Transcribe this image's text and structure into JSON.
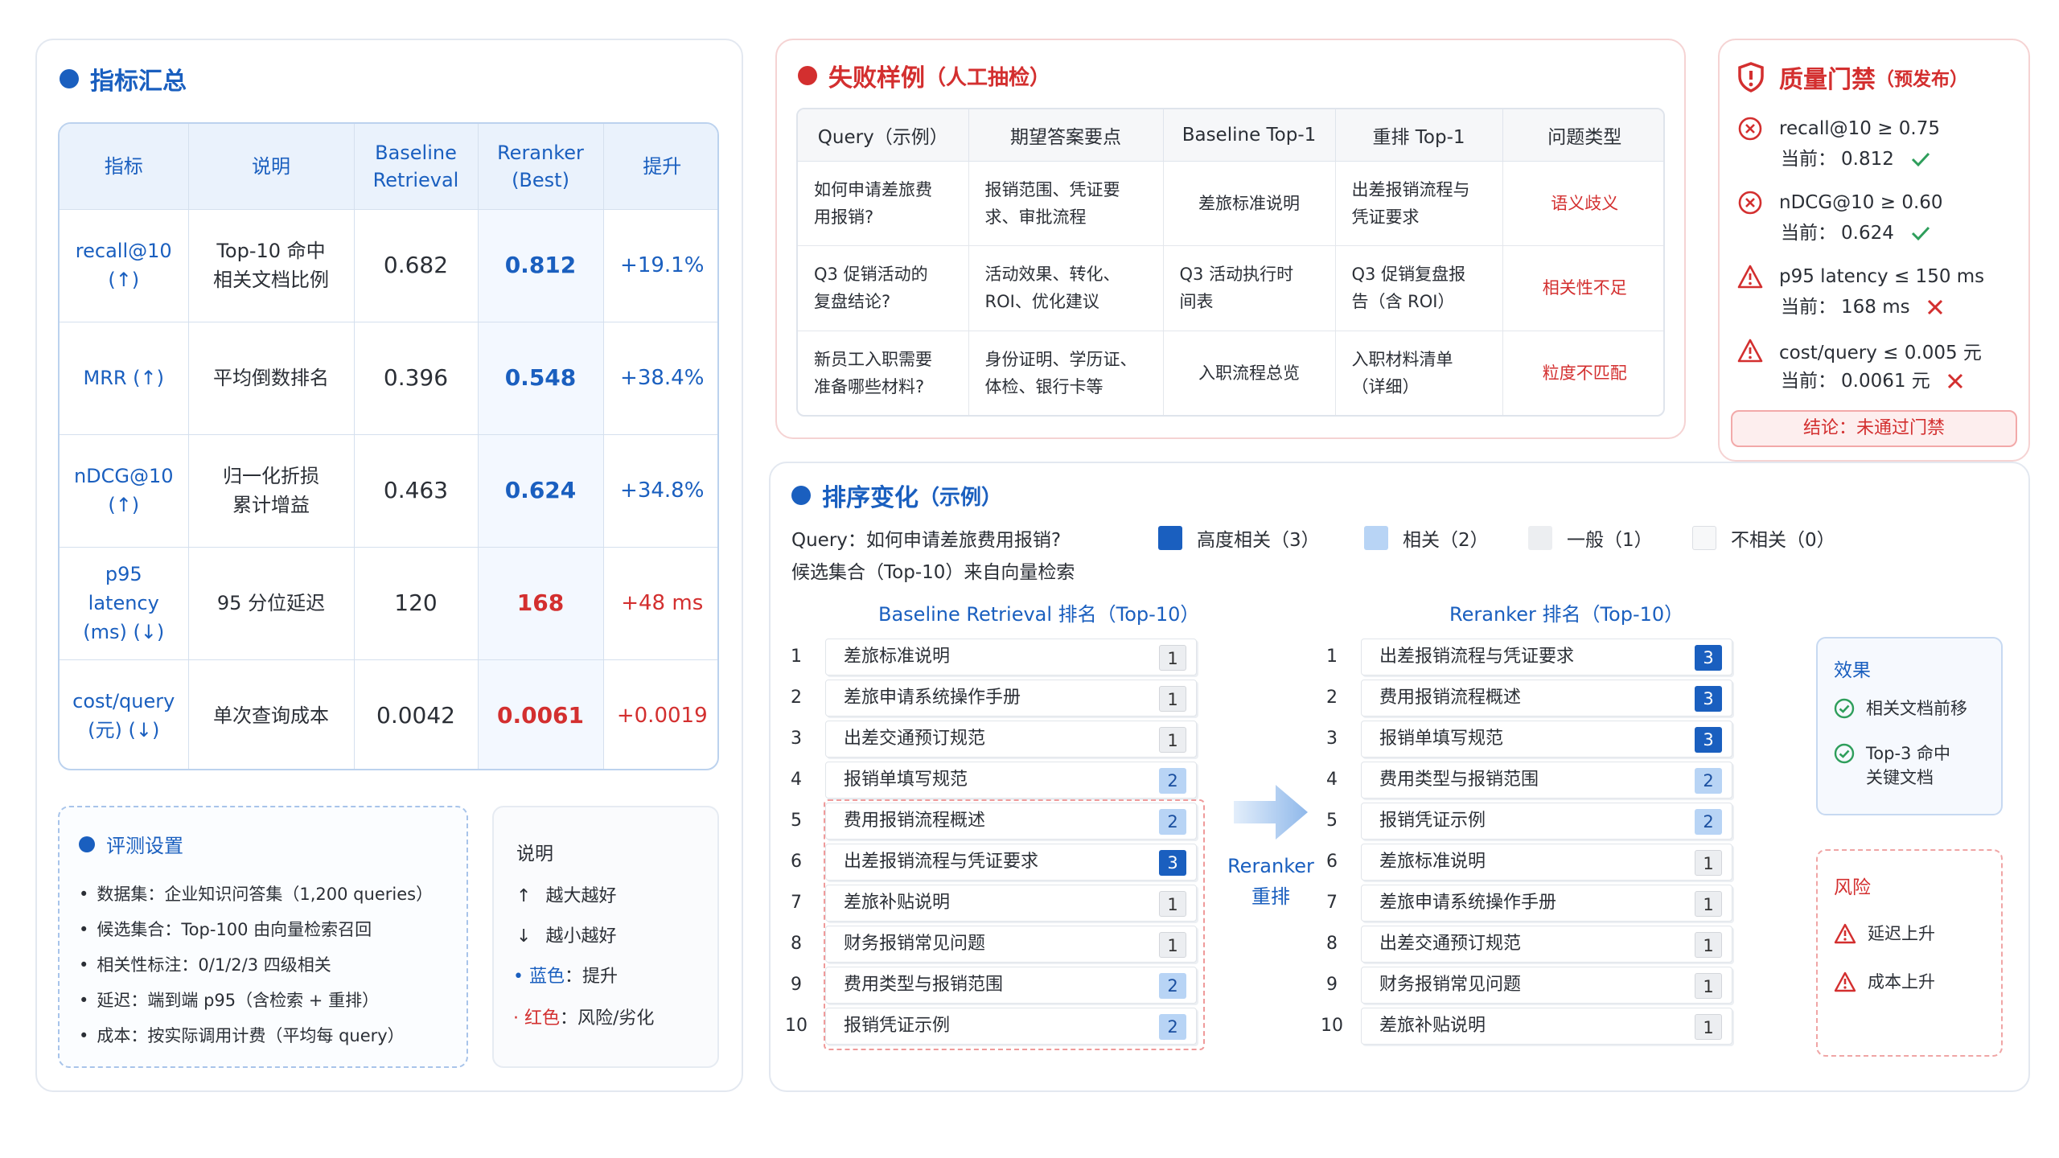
{
  "metrics": {
    "title": "指标汇总",
    "headers": [
      "指标",
      "说明",
      "Baseline Retrieval",
      "Reranker (Best)",
      "提升"
    ],
    "rows": [
      {
        "metric": "recall@10 (↑)",
        "desc": "Top-10 命中 相关文档比例",
        "baseline": "0.682",
        "reranker": "0.812",
        "gain": "+19.1%",
        "bad": false
      },
      {
        "metric": "MRR (↑)",
        "desc": "平均倒数排名",
        "baseline": "0.396",
        "reranker": "0.548",
        "gain": "+38.4%",
        "bad": false
      },
      {
        "metric": "nDCG@10 (↑)",
        "desc": "归一化折损 累计增益",
        "baseline": "0.463",
        "reranker": "0.624",
        "gain": "+34.8%",
        "bad": false
      },
      {
        "metric": "p95 latency (ms) (↓)",
        "desc": "95 分位延迟",
        "baseline": "120",
        "reranker": "168",
        "gain": "+48 ms",
        "bad": true
      },
      {
        "metric": "cost/query (元) (↓)",
        "desc": "单次查询成本",
        "baseline": "0.0042",
        "reranker": "0.0061",
        "gain": "+0.0019",
        "bad": true
      }
    ]
  },
  "settings": {
    "title": "评测设置",
    "items": [
      "数据集：企业知识问答集（1,200 queries）",
      "候选集合：Top-100 由向量检索召回",
      "相关性标注：0/1/2/3 四级相关",
      "延迟：端到端 p95（含检索 + 重排）",
      "成本：按实际调用计费（平均每 query）"
    ]
  },
  "legend": {
    "title": "说明",
    "up": "越大越好",
    "down": "越小越好",
    "blue_label": "蓝色",
    "blue_text": "：提升",
    "red_label": "红色",
    "red_text": "：风险/劣化"
  },
  "failures": {
    "title": "失败样例",
    "title_sub": "（人工抽检）",
    "headers": [
      "Query（示例）",
      "期望答案要点",
      "Baseline Top-1",
      "重排 Top-1",
      "问题类型"
    ],
    "rows": [
      {
        "query": "如何申请差旅费用报销?",
        "expected": "报销范围、凭证要求、审批流程",
        "baseline": "差旅标准说明",
        "rerank": "出差报销流程与凭证要求",
        "issue": "语义歧义"
      },
      {
        "query": "Q3 促销活动的复盘结论?",
        "expected": "活动效果、转化、ROI、优化建议",
        "baseline": "Q3 活动执行时间表",
        "rerank": "Q3 促销复盘报告（含 ROI）",
        "issue": "相关性不足"
      },
      {
        "query": "新员工入职需要准备哪些材料?",
        "expected": "身份证明、学历证、体检、银行卡等",
        "baseline": "入职流程总览",
        "rerank": "入职材料清单（详细）",
        "issue": "粒度不匹配"
      }
    ]
  },
  "gate": {
    "title": "质量门禁",
    "title_sub": "（预发布）",
    "items": [
      {
        "criterion": "recall@10 ≥ 0.75",
        "current_label": "当前：",
        "current": "0.812",
        "pass": true,
        "icon": "x-circle-icon"
      },
      {
        "criterion": "nDCG@10 ≥ 0.60",
        "current_label": "当前：",
        "current": "0.624",
        "pass": true,
        "icon": "x-circle-icon"
      },
      {
        "criterion": "p95 latency ≤ 150 ms",
        "current_label": "当前：",
        "current": "168 ms",
        "pass": false,
        "icon": "warning-icon"
      },
      {
        "criterion": "cost/query ≤ 0.005 元",
        "current_label": "当前：",
        "current": "0.0061 元",
        "pass": false,
        "icon": "warning-icon"
      }
    ],
    "verdict": "结论：未通过门禁"
  },
  "ranking": {
    "title": "排序变化",
    "title_sub": "（示例）",
    "query": "Query：如何申请差旅费用报销?",
    "candidates": "候选集合（Top-10）来自向量检索",
    "legend": [
      {
        "label": "高度相关（3）",
        "color": "#1a5fbf"
      },
      {
        "label": "相关（2）",
        "color": "#b8d4f5"
      },
      {
        "label": "一般（1）",
        "color": "#eceef1"
      },
      {
        "label": "不相关（0）",
        "color": "#f7f8f9"
      }
    ],
    "baseline_title": "Baseline Retrieval 排名（Top-10）",
    "reranker_title": "Reranker 排名（Top-10）",
    "arrow_label_1": "Reranker",
    "arrow_label_2": "重排",
    "baseline": [
      {
        "rank": "1",
        "doc": "差旅标准说明",
        "score": "1"
      },
      {
        "rank": "2",
        "doc": "差旅申请系统操作手册",
        "score": "1"
      },
      {
        "rank": "3",
        "doc": "出差交通预订规范",
        "score": "1"
      },
      {
        "rank": "4",
        "doc": "报销单填写规范",
        "score": "2"
      },
      {
        "rank": "5",
        "doc": "费用报销流程概述",
        "score": "2"
      },
      {
        "rank": "6",
        "doc": "出差报销流程与凭证要求",
        "score": "3"
      },
      {
        "rank": "7",
        "doc": "差旅补贴说明",
        "score": "1"
      },
      {
        "rank": "8",
        "doc": "财务报销常见问题",
        "score": "1"
      },
      {
        "rank": "9",
        "doc": "费用类型与报销范围",
        "score": "2"
      },
      {
        "rank": "10",
        "doc": "报销凭证示例",
        "score": "2"
      }
    ],
    "reranker": [
      {
        "rank": "1",
        "doc": "出差报销流程与凭证要求",
        "score": "3"
      },
      {
        "rank": "2",
        "doc": "费用报销流程概述",
        "score": "3"
      },
      {
        "rank": "3",
        "doc": "报销单填写规范",
        "score": "3"
      },
      {
        "rank": "4",
        "doc": "费用类型与报销范围",
        "score": "2"
      },
      {
        "rank": "5",
        "doc": "报销凭证示例",
        "score": "2"
      },
      {
        "rank": "6",
        "doc": "差旅标准说明",
        "score": "1"
      },
      {
        "rank": "7",
        "doc": "差旅申请系统操作手册",
        "score": "1"
      },
      {
        "rank": "8",
        "doc": "出差交通预订规范",
        "score": "1"
      },
      {
        "rank": "9",
        "doc": "财务报销常见问题",
        "score": "1"
      },
      {
        "rank": "10",
        "doc": "差旅补贴说明",
        "score": "1"
      }
    ],
    "effect": {
      "title": "效果",
      "items": [
        "相关文档前移",
        "Top-3 命中 关键文档"
      ]
    },
    "risk": {
      "title": "风险",
      "items": [
        "延迟上升",
        "成本上升"
      ]
    }
  },
  "colors": {
    "accent": "#1a5fbf",
    "danger": "#d32f2f",
    "success": "#2e9e5b"
  }
}
